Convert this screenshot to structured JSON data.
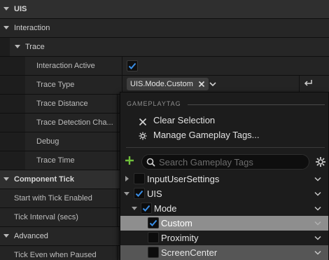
{
  "details": {
    "categories": {
      "uis": "UIS",
      "interaction": "Interaction",
      "trace": "Trace",
      "component_tick": "Component Tick",
      "advanced": "Advanced"
    },
    "props": {
      "interaction_active": "Interaction Active",
      "trace_type": "Trace Type",
      "trace_distance": "Trace Distance",
      "trace_detection_channel": "Trace Detection Cha...",
      "debug": "Debug",
      "trace_time": "Trace Time",
      "start_with_tick": "Start with Tick Enabled",
      "tick_interval": "Tick Interval (secs)",
      "tick_even_paused": "Tick Even when Paused"
    },
    "trace_type_value": "UIS.Mode.Custom",
    "interaction_active_checked": true
  },
  "popup": {
    "header": "GAMEPLAYTAG",
    "clear_selection": "Clear Selection",
    "manage_tags": "Manage Gameplay Tags...",
    "search_placeholder": "Search Gameplay Tags",
    "accent_color": "#3a8ee6",
    "add_color": "#6fbf3a",
    "tree": [
      {
        "label": "InputUserSettings",
        "checked": false,
        "expander": "collapsed",
        "state": "normal"
      },
      {
        "label": "UIS",
        "checked": true,
        "expander": "expanded",
        "state": "normal"
      },
      {
        "label": "Mode",
        "checked": true,
        "expander": "expanded",
        "state": "normal"
      },
      {
        "label": "Custom",
        "checked": true,
        "expander": "none",
        "state": "selected"
      },
      {
        "label": "Proximity",
        "checked": false,
        "expander": "none",
        "state": "normal"
      },
      {
        "label": "ScreenCenter",
        "checked": false,
        "expander": "none",
        "state": "hovered"
      }
    ]
  }
}
